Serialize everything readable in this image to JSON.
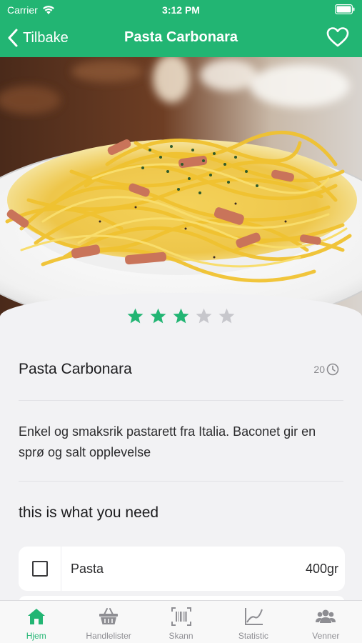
{
  "status_bar": {
    "carrier": "Carrier",
    "time": "3:12 PM"
  },
  "nav": {
    "back_label": "Tilbake",
    "title": "Pasta Carbonara",
    "favorite_icon": "heart-outline-icon"
  },
  "colors": {
    "brand_green": "#22b573",
    "star_filled": "#22b573",
    "star_empty": "#c7c7cc",
    "tab_inactive": "#8e8e93"
  },
  "hero": {
    "image_subject": "plate of spaghetti carbonara with bacon and herbs"
  },
  "rating": {
    "value": 3,
    "max": 5
  },
  "recipe": {
    "name": "Pasta Carbonara",
    "time": "20",
    "time_icon": "clock-icon",
    "description": "Enkel og smaksrik pastarett fra Italia. Baconet gir en sprø og salt opplevelse"
  },
  "ingredients_section": {
    "heading": "this is what you need",
    "items": [
      {
        "name": "Pasta",
        "amount": "400gr",
        "checked": false
      }
    ]
  },
  "tab_bar": {
    "tabs": [
      {
        "label": "Hjem",
        "icon": "home-icon",
        "active": true
      },
      {
        "label": "Handlelister",
        "icon": "basket-icon",
        "active": false
      },
      {
        "label": "Skann",
        "icon": "barcode-icon",
        "active": false
      },
      {
        "label": "Statistic",
        "icon": "chart-icon",
        "active": false
      },
      {
        "label": "Venner",
        "icon": "people-icon",
        "active": false
      }
    ]
  }
}
